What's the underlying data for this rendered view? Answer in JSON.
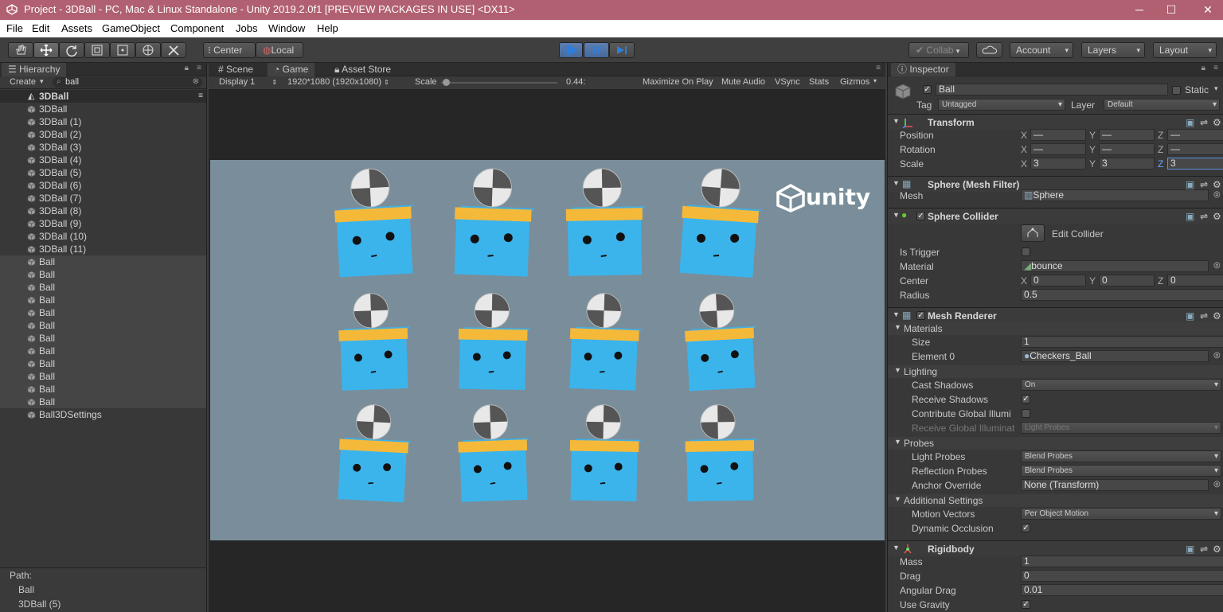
{
  "window": {
    "title": "Project - 3DBall - PC, Mac & Linux Standalone - Unity 2019.2.0f1 [PREVIEW PACKAGES IN USE] <DX11>",
    "min": "─",
    "max": "☐",
    "close": "✕"
  },
  "menu": [
    "File",
    "Edit",
    "Assets",
    "GameObject",
    "Component",
    "Jobs",
    "Window",
    "Help"
  ],
  "toolbar": {
    "center": "Center",
    "local": "Local",
    "collab": "Collab",
    "account": "Account",
    "layers": "Layers",
    "layout": "Layout"
  },
  "hierarchy": {
    "tab": "Hierarchy",
    "create": "Create",
    "search": "ball",
    "scene": "3DBall",
    "items": [
      {
        "label": "3DBall",
        "sel": false
      },
      {
        "label": "3DBall (1)",
        "sel": false
      },
      {
        "label": "3DBall (2)",
        "sel": false
      },
      {
        "label": "3DBall (3)",
        "sel": false
      },
      {
        "label": "3DBall (4)",
        "sel": false
      },
      {
        "label": "3DBall (5)",
        "sel": false
      },
      {
        "label": "3DBall (6)",
        "sel": false
      },
      {
        "label": "3DBall (7)",
        "sel": false
      },
      {
        "label": "3DBall (8)",
        "sel": false
      },
      {
        "label": "3DBall (9)",
        "sel": false
      },
      {
        "label": "3DBall (10)",
        "sel": false
      },
      {
        "label": "3DBall (11)",
        "sel": false
      },
      {
        "label": "Ball",
        "sel": true
      },
      {
        "label": "Ball",
        "sel": true
      },
      {
        "label": "Ball",
        "sel": true
      },
      {
        "label": "Ball",
        "sel": true
      },
      {
        "label": "Ball",
        "sel": true
      },
      {
        "label": "Ball",
        "sel": true
      },
      {
        "label": "Ball",
        "sel": true
      },
      {
        "label": "Ball",
        "sel": true
      },
      {
        "label": "Ball",
        "sel": true
      },
      {
        "label": "Ball",
        "sel": true
      },
      {
        "label": "Ball",
        "sel": true
      },
      {
        "label": "Ball",
        "sel": true
      },
      {
        "label": "Ball3DSettings",
        "sel": false
      }
    ],
    "path_label": "Path:",
    "path_items": [
      "Ball",
      "3DBall (5)"
    ]
  },
  "tabs": {
    "scene": "Scene",
    "game": "Game",
    "asset_store": "Asset Store"
  },
  "game": {
    "display": "Display 1",
    "resolution": "1920*1080 (1920x1080)",
    "scale_label": "Scale",
    "scale_value": "0.44:",
    "maximize": "Maximize On Play",
    "mute": "Mute Audio",
    "vsync": "VSync",
    "stats": "Stats",
    "gizmos": "Gizmos",
    "logo": "unity"
  },
  "inspector": {
    "tab": "Inspector",
    "name": "Ball",
    "static": "Static",
    "tag_label": "Tag",
    "tag": "Untagged",
    "layer_label": "Layer",
    "layer": "Default",
    "transform": {
      "title": "Transform",
      "position": "Position",
      "rotation": "Rotation",
      "scale": "Scale",
      "pos": [
        "—",
        "—",
        "—"
      ],
      "rot": [
        "—",
        "—",
        "—"
      ],
      "scl": [
        "3",
        "3",
        "3"
      ]
    },
    "axes": [
      "X",
      "Y",
      "Z"
    ],
    "mesh_filter": {
      "title": "Sphere (Mesh Filter)",
      "mesh_label": "Mesh",
      "mesh": "Sphere"
    },
    "collider": {
      "title": "Sphere Collider",
      "edit": "Edit Collider",
      "is_trigger": "Is Trigger",
      "material_label": "Material",
      "material": "bounce",
      "center_label": "Center",
      "center": [
        "0",
        "0",
        "0"
      ],
      "radius_label": "Radius",
      "radius": "0.5"
    },
    "renderer": {
      "title": "Mesh Renderer",
      "materials": "Materials",
      "size_label": "Size",
      "size": "1",
      "element_label": "Element 0",
      "element": "Checkers_Ball",
      "lighting": "Lighting",
      "cast_label": "Cast Shadows",
      "cast": "On",
      "receive_label": "Receive Shadows",
      "contrib_label": "Contribute Global Illumi",
      "receive_gi_label": "Receive Global Illuminat",
      "receive_gi": "Light Probes",
      "probes": "Probes",
      "light_probes_label": "Light Probes",
      "light_probes": "Blend Probes",
      "refl_label": "Reflection Probes",
      "refl": "Blend Probes",
      "anchor_label": "Anchor Override",
      "anchor": "None (Transform)",
      "additional": "Additional Settings",
      "motion_label": "Motion Vectors",
      "motion": "Per Object Motion",
      "dyn_label": "Dynamic Occlusion"
    },
    "rigidbody": {
      "title": "Rigidbody",
      "mass_label": "Mass",
      "mass": "1",
      "drag_label": "Drag",
      "drag": "0",
      "ang_label": "Angular Drag",
      "ang": "0.01",
      "grav_label": "Use Gravity"
    }
  },
  "colors": {
    "title_bar": "#b06070",
    "game_bg": "#798e9a",
    "box_blue": "#3bb4ec",
    "band_yellow": "#f5b93a",
    "selection": "#454545"
  }
}
